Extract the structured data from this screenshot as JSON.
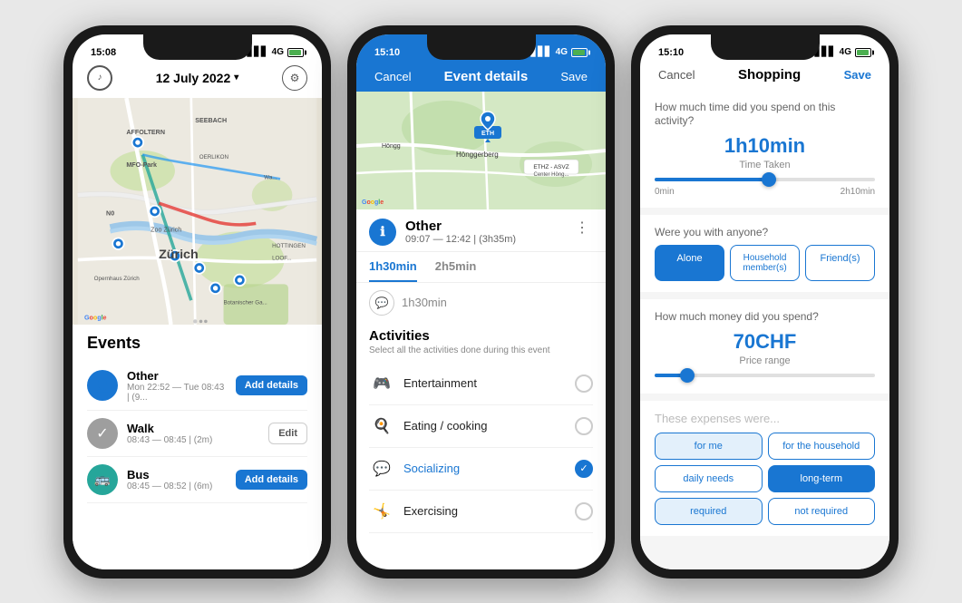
{
  "phone1": {
    "status_time": "15:08",
    "status_network": "4G",
    "date_label": "12 July 2022",
    "date_arrow": "▾",
    "events_title": "Events",
    "events": [
      {
        "id": "other",
        "icon": "👤",
        "icon_type": "blue",
        "name": "Other",
        "time": "Mon 22:52 — Tue 08:43 | (9...",
        "btn_label": "Add details",
        "btn_type": "primary"
      },
      {
        "id": "walk",
        "icon": "✓",
        "icon_type": "gray",
        "name": "Walk",
        "time": "08:43 — 08:45 | (2m)",
        "btn_label": "Edit",
        "btn_type": "secondary"
      },
      {
        "id": "bus",
        "icon": "🚌",
        "icon_type": "teal",
        "name": "Bus",
        "time": "08:45 — 08:52 | (6m)",
        "btn_label": "Add details",
        "btn_type": "primary"
      }
    ]
  },
  "phone2": {
    "status_time": "15:10",
    "status_network": "4G",
    "header_title": "Event details",
    "cancel_label": "Cancel",
    "save_label": "Save",
    "event_name": "Other",
    "event_time": "09:07 — 12:42 | (3h35m)",
    "tab1_label": "1h30min",
    "tab2_label": "2h5min",
    "chat_time": "1h30min",
    "activities_title": "Activities",
    "activities_subtitle": "Select all the activities done during this event",
    "activities": [
      {
        "id": "entertainment",
        "icon": "🎮",
        "name": "Entertainment",
        "checked": false
      },
      {
        "id": "eating",
        "icon": "🍳",
        "name": "Eating / cooking",
        "checked": false
      },
      {
        "id": "socializing",
        "icon": "💬",
        "name": "Socializing",
        "checked": true,
        "active": true
      },
      {
        "id": "exercising",
        "icon": "🤸",
        "name": "Exercising",
        "checked": false
      }
    ]
  },
  "phone3": {
    "status_time": "15:10",
    "status_network": "4G",
    "cancel_label": "Cancel",
    "title": "Shopping",
    "save_label": "Save",
    "question1": "How much time did you spend on this activity?",
    "time_value": "1h10min",
    "time_label": "Time Taken",
    "slider1_min": "0min",
    "slider1_max": "2h10min",
    "slider1_pct": 52,
    "question2": "Were you with anyone?",
    "companions": [
      "Alone",
      "Household member(s)",
      "Friend(s)"
    ],
    "companion_selected": 0,
    "question3": "How much money did you spend?",
    "money_value": "70CHF",
    "money_label": "Price range",
    "slider2_pct": 15,
    "expenses_placeholder": "These expenses were...",
    "expense_btns": [
      {
        "label": "for me",
        "selected": true
      },
      {
        "label": "for the household",
        "selected": false
      }
    ],
    "expense_btns2": [
      {
        "label": "daily needs",
        "selected": false
      },
      {
        "label": "long-term",
        "selected": true
      }
    ],
    "expense_btns3": [
      {
        "label": "required",
        "selected": true
      },
      {
        "label": "not required",
        "selected": false
      }
    ]
  }
}
